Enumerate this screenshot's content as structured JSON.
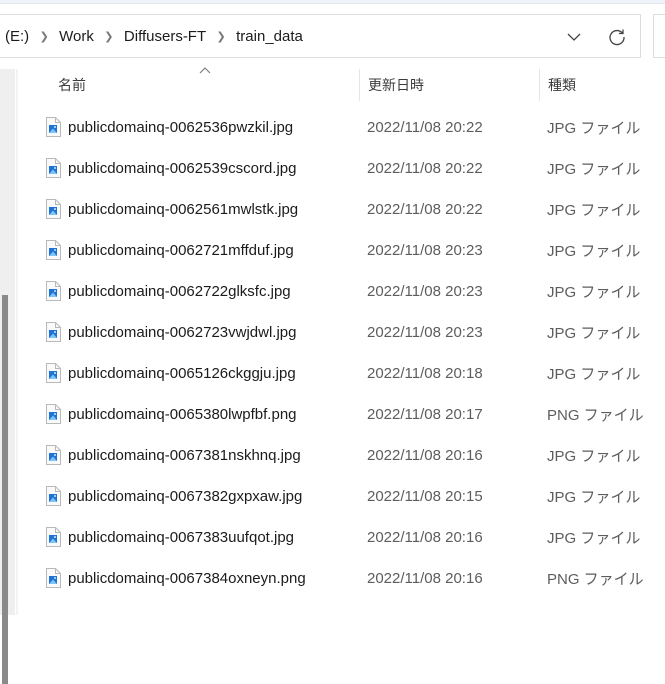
{
  "address_bar": {
    "breadcrumb": [
      {
        "label": "(E:)"
      },
      {
        "label": "Work"
      },
      {
        "label": "Diffusers-FT"
      },
      {
        "label": "train_data"
      }
    ],
    "dropdown_icon": "chevron-down-icon",
    "refresh_icon": "refresh-icon"
  },
  "columns": {
    "name": "名前",
    "date": "更新日時",
    "type": "種類",
    "sort_indicator": "sort-ascending-icon"
  },
  "files": [
    {
      "name": "publicdomainq-0062536pwzkil.jpg",
      "date": "2022/11/08 20:22",
      "type": "JPG ファイル"
    },
    {
      "name": "publicdomainq-0062539cscord.jpg",
      "date": "2022/11/08 20:22",
      "type": "JPG ファイル"
    },
    {
      "name": "publicdomainq-0062561mwlstk.jpg",
      "date": "2022/11/08 20:22",
      "type": "JPG ファイル"
    },
    {
      "name": "publicdomainq-0062721mffduf.jpg",
      "date": "2022/11/08 20:23",
      "type": "JPG ファイル"
    },
    {
      "name": "publicdomainq-0062722glksfc.jpg",
      "date": "2022/11/08 20:23",
      "type": "JPG ファイル"
    },
    {
      "name": "publicdomainq-0062723vwjdwl.jpg",
      "date": "2022/11/08 20:23",
      "type": "JPG ファイル"
    },
    {
      "name": "publicdomainq-0065126ckggju.jpg",
      "date": "2022/11/08 20:18",
      "type": "JPG ファイル"
    },
    {
      "name": "publicdomainq-0065380lwpfbf.png",
      "date": "2022/11/08 20:17",
      "type": "PNG ファイル"
    },
    {
      "name": "publicdomainq-0067381nskhnq.jpg",
      "date": "2022/11/08 20:16",
      "type": "JPG ファイル"
    },
    {
      "name": "publicdomainq-0067382gxpxaw.jpg",
      "date": "2022/11/08 20:15",
      "type": "JPG ファイル"
    },
    {
      "name": "publicdomainq-0067383uufqot.jpg",
      "date": "2022/11/08 20:16",
      "type": "JPG ファイル"
    },
    {
      "name": "publicdomainq-0067384oxneyn.png",
      "date": "2022/11/08 20:16",
      "type": "PNG ファイル"
    }
  ],
  "colors": {
    "icon_blue": "#1e74d6",
    "text_primary": "#1b1b1b",
    "text_secondary": "#5d5d5d",
    "scroll_thumb": "#8a8a8a"
  }
}
